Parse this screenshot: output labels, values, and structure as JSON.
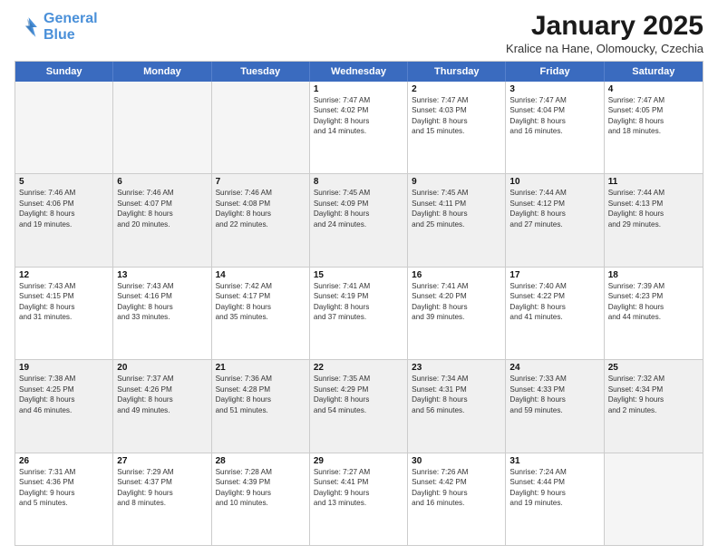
{
  "header": {
    "logo_line1": "General",
    "logo_line2": "Blue",
    "month": "January 2025",
    "location": "Kralice na Hane, Olomoucky, Czechia"
  },
  "weekdays": [
    "Sunday",
    "Monday",
    "Tuesday",
    "Wednesday",
    "Thursday",
    "Friday",
    "Saturday"
  ],
  "rows": [
    [
      {
        "day": "",
        "lines": []
      },
      {
        "day": "",
        "lines": []
      },
      {
        "day": "",
        "lines": []
      },
      {
        "day": "1",
        "lines": [
          "Sunrise: 7:47 AM",
          "Sunset: 4:02 PM",
          "Daylight: 8 hours",
          "and 14 minutes."
        ]
      },
      {
        "day": "2",
        "lines": [
          "Sunrise: 7:47 AM",
          "Sunset: 4:03 PM",
          "Daylight: 8 hours",
          "and 15 minutes."
        ]
      },
      {
        "day": "3",
        "lines": [
          "Sunrise: 7:47 AM",
          "Sunset: 4:04 PM",
          "Daylight: 8 hours",
          "and 16 minutes."
        ]
      },
      {
        "day": "4",
        "lines": [
          "Sunrise: 7:47 AM",
          "Sunset: 4:05 PM",
          "Daylight: 8 hours",
          "and 18 minutes."
        ]
      }
    ],
    [
      {
        "day": "5",
        "lines": [
          "Sunrise: 7:46 AM",
          "Sunset: 4:06 PM",
          "Daylight: 8 hours",
          "and 19 minutes."
        ]
      },
      {
        "day": "6",
        "lines": [
          "Sunrise: 7:46 AM",
          "Sunset: 4:07 PM",
          "Daylight: 8 hours",
          "and 20 minutes."
        ]
      },
      {
        "day": "7",
        "lines": [
          "Sunrise: 7:46 AM",
          "Sunset: 4:08 PM",
          "Daylight: 8 hours",
          "and 22 minutes."
        ]
      },
      {
        "day": "8",
        "lines": [
          "Sunrise: 7:45 AM",
          "Sunset: 4:09 PM",
          "Daylight: 8 hours",
          "and 24 minutes."
        ]
      },
      {
        "day": "9",
        "lines": [
          "Sunrise: 7:45 AM",
          "Sunset: 4:11 PM",
          "Daylight: 8 hours",
          "and 25 minutes."
        ]
      },
      {
        "day": "10",
        "lines": [
          "Sunrise: 7:44 AM",
          "Sunset: 4:12 PM",
          "Daylight: 8 hours",
          "and 27 minutes."
        ]
      },
      {
        "day": "11",
        "lines": [
          "Sunrise: 7:44 AM",
          "Sunset: 4:13 PM",
          "Daylight: 8 hours",
          "and 29 minutes."
        ]
      }
    ],
    [
      {
        "day": "12",
        "lines": [
          "Sunrise: 7:43 AM",
          "Sunset: 4:15 PM",
          "Daylight: 8 hours",
          "and 31 minutes."
        ]
      },
      {
        "day": "13",
        "lines": [
          "Sunrise: 7:43 AM",
          "Sunset: 4:16 PM",
          "Daylight: 8 hours",
          "and 33 minutes."
        ]
      },
      {
        "day": "14",
        "lines": [
          "Sunrise: 7:42 AM",
          "Sunset: 4:17 PM",
          "Daylight: 8 hours",
          "and 35 minutes."
        ]
      },
      {
        "day": "15",
        "lines": [
          "Sunrise: 7:41 AM",
          "Sunset: 4:19 PM",
          "Daylight: 8 hours",
          "and 37 minutes."
        ]
      },
      {
        "day": "16",
        "lines": [
          "Sunrise: 7:41 AM",
          "Sunset: 4:20 PM",
          "Daylight: 8 hours",
          "and 39 minutes."
        ]
      },
      {
        "day": "17",
        "lines": [
          "Sunrise: 7:40 AM",
          "Sunset: 4:22 PM",
          "Daylight: 8 hours",
          "and 41 minutes."
        ]
      },
      {
        "day": "18",
        "lines": [
          "Sunrise: 7:39 AM",
          "Sunset: 4:23 PM",
          "Daylight: 8 hours",
          "and 44 minutes."
        ]
      }
    ],
    [
      {
        "day": "19",
        "lines": [
          "Sunrise: 7:38 AM",
          "Sunset: 4:25 PM",
          "Daylight: 8 hours",
          "and 46 minutes."
        ]
      },
      {
        "day": "20",
        "lines": [
          "Sunrise: 7:37 AM",
          "Sunset: 4:26 PM",
          "Daylight: 8 hours",
          "and 49 minutes."
        ]
      },
      {
        "day": "21",
        "lines": [
          "Sunrise: 7:36 AM",
          "Sunset: 4:28 PM",
          "Daylight: 8 hours",
          "and 51 minutes."
        ]
      },
      {
        "day": "22",
        "lines": [
          "Sunrise: 7:35 AM",
          "Sunset: 4:29 PM",
          "Daylight: 8 hours",
          "and 54 minutes."
        ]
      },
      {
        "day": "23",
        "lines": [
          "Sunrise: 7:34 AM",
          "Sunset: 4:31 PM",
          "Daylight: 8 hours",
          "and 56 minutes."
        ]
      },
      {
        "day": "24",
        "lines": [
          "Sunrise: 7:33 AM",
          "Sunset: 4:33 PM",
          "Daylight: 8 hours",
          "and 59 minutes."
        ]
      },
      {
        "day": "25",
        "lines": [
          "Sunrise: 7:32 AM",
          "Sunset: 4:34 PM",
          "Daylight: 9 hours",
          "and 2 minutes."
        ]
      }
    ],
    [
      {
        "day": "26",
        "lines": [
          "Sunrise: 7:31 AM",
          "Sunset: 4:36 PM",
          "Daylight: 9 hours",
          "and 5 minutes."
        ]
      },
      {
        "day": "27",
        "lines": [
          "Sunrise: 7:29 AM",
          "Sunset: 4:37 PM",
          "Daylight: 9 hours",
          "and 8 minutes."
        ]
      },
      {
        "day": "28",
        "lines": [
          "Sunrise: 7:28 AM",
          "Sunset: 4:39 PM",
          "Daylight: 9 hours",
          "and 10 minutes."
        ]
      },
      {
        "day": "29",
        "lines": [
          "Sunrise: 7:27 AM",
          "Sunset: 4:41 PM",
          "Daylight: 9 hours",
          "and 13 minutes."
        ]
      },
      {
        "day": "30",
        "lines": [
          "Sunrise: 7:26 AM",
          "Sunset: 4:42 PM",
          "Daylight: 9 hours",
          "and 16 minutes."
        ]
      },
      {
        "day": "31",
        "lines": [
          "Sunrise: 7:24 AM",
          "Sunset: 4:44 PM",
          "Daylight: 9 hours",
          "and 19 minutes."
        ]
      },
      {
        "day": "",
        "lines": []
      }
    ]
  ]
}
